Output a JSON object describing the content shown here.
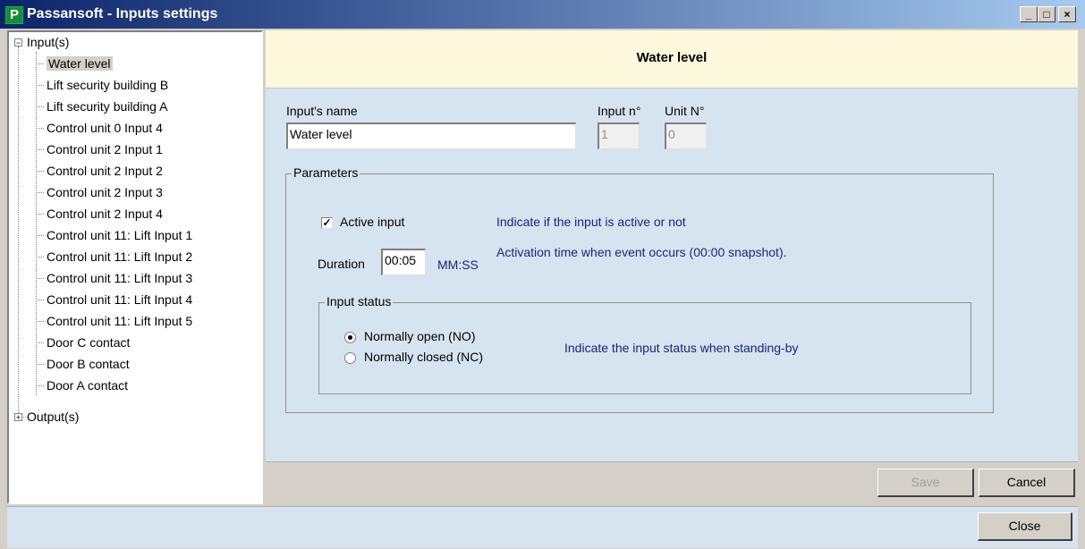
{
  "window": {
    "title": "Passansoft - Inputs settings",
    "icon_letter": "P",
    "minimize_label": "_",
    "maximize_label": "□",
    "close_label": "×"
  },
  "tree": {
    "inputs_label": "Input(s)",
    "outputs_label": "Output(s)",
    "inputs_expander": "−",
    "outputs_expander": "+",
    "items": [
      "Water level",
      "Lift security building B",
      "Lift security building A",
      "Control unit 0 Input 4",
      "Control unit 2 Input 1",
      "Control unit 2 Input 2",
      "Control unit 2 Input 3",
      "Control unit 2 Input 4",
      "Control unit 11: Lift Input 1",
      "Control unit 11: Lift Input 2",
      "Control unit 11: Lift Input 3",
      "Control unit 11: Lift Input 4",
      "Control unit 11: Lift Input 5",
      "Door C contact",
      "Door B contact",
      "Door A contact"
    ],
    "selected_index": 0
  },
  "main": {
    "header_title": "Water level",
    "input_name_label": "Input's name",
    "input_name_value": "Water level",
    "input_number_label": "Input n°",
    "input_number_value": "1",
    "unit_number_label": "Unit N°",
    "unit_number_value": "0",
    "parameters": {
      "legend": "Parameters",
      "active_input_label": "Active input",
      "active_input_checked": true,
      "active_input_check_glyph": "✓",
      "active_input_help": "Indicate if the input is active or not",
      "duration_label": "Duration",
      "duration_value": "00:05",
      "duration_unit": "MM:SS",
      "duration_help": "Activation time when event occurs (00:00 snapshot).",
      "input_status": {
        "legend": "Input status",
        "options": [
          "Normally open (NO)",
          "Normally closed (NC)"
        ],
        "selected_index": 0,
        "help": "Indicate the input status when standing-by"
      }
    },
    "save_label": "Save",
    "cancel_label": "Cancel"
  },
  "footer": {
    "close_label": "Close"
  }
}
